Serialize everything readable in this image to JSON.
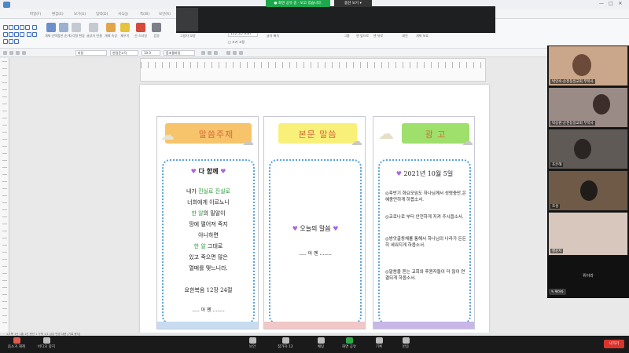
{
  "window": {
    "share_banner": "● 화면 공유 중 · 보고 있습니다.",
    "view_button": "옵션 보기 ▾",
    "controls": [
      "—",
      "□",
      "✕"
    ]
  },
  "menu": [
    "파일(F)",
    "편집(E)",
    "보기(U)",
    "입력(D)",
    "서식(J)",
    "쪽(W)",
    "보안(R)"
  ],
  "ribbon": {
    "buttons": [
      "개체 선택",
      "합판 순기",
      "다각형 편집",
      "글상자 연결",
      "개체 속성",
      "채우기",
      "선 스타일",
      "음영",
      "그림자 모양",
      "글자 배치",
      "그룹",
      "맨 앞으로",
      "맨 뒤로",
      "회전",
      "개체 보호"
    ],
    "font_size": "122.35",
    "font_unit": "mm",
    "grid_label": "□ 크기 고정"
  },
  "format": {
    "style": "바탕",
    "font": "한컴윤고딕",
    "size": "10.0",
    "font2": "함초롬바탕"
  },
  "panels": {
    "p1": {
      "header": "말씀주제",
      "title": "다 함께",
      "poem_lines": [
        {
          "pre": "내가 ",
          "hl": "진실로 진실로",
          "post": ""
        },
        {
          "pre": "너희에게 이르노니",
          "hl": "",
          "post": ""
        },
        {
          "pre": "",
          "hl": "한 알",
          "post": "의 밀알이"
        },
        {
          "pre": "땅에 떨어져 죽지",
          "hl": "",
          "post": ""
        },
        {
          "pre": "아니하면",
          "hl": "",
          "post": ""
        },
        {
          "pre": "",
          "hl": "한 알",
          "post": " 그대로"
        },
        {
          "pre": "있고 죽으면 많은",
          "hl": "",
          "post": ""
        },
        {
          "pre": "열매를 맺느니라.",
          "hl": "",
          "post": ""
        }
      ],
      "reference": "요한복음 12장 24절",
      "amen": "..... 아 멘 ........"
    },
    "p2": {
      "header": "본문 말씀",
      "title": "오늘의 말씀",
      "amen": "..... 아 멘 ........"
    },
    "p3": {
      "header": "광      고",
      "date": "2021년 10월 5일",
      "items": [
        "◎후반기 화요모임도 하나님께서 성령충만,은혜충만하게 하옵소서.",
        "◎코로나로 부터 안전하게 지켜 주시옵소서.",
        "◎방앗골동체를 통해서 하나님의 나라가 든든히 세워지게 하옵소서.",
        "◎말씀을 듣는 교회와 후원자들이 더 많이 연결되게 하옵소서."
      ]
    }
  },
  "gallery": {
    "participants": [
      {
        "name": "박인숙-순천동일교회 부목사"
      },
      {
        "name": "박승원-순천동일교회 부목사"
      },
      {
        "name": "조은혜"
      },
      {
        "name": "조성"
      },
      {
        "name": "황윤지"
      }
    ],
    "more": "위아라",
    "mic_chip": "✎ 위아라"
  },
  "statusbar": "1/1쪽  1단  1줄  1칸  문단 1  구역 1/1  삽입  변경 내용 [기록 중지]",
  "zoombar": {
    "items": [
      "음소거 해제",
      "비디오 중지",
      "보안",
      "참가자",
      "채팅",
      "화면 공유",
      "기록",
      "반응"
    ],
    "participant_count": "12",
    "leave": "나가기"
  },
  "colors": {
    "header1": "#f7c46b",
    "header2": "#f9f07a",
    "header3": "#9ee06b",
    "dotted": "#5aa4de",
    "highlight_green": "#2c9c3c",
    "heart": "#a66ad8"
  }
}
